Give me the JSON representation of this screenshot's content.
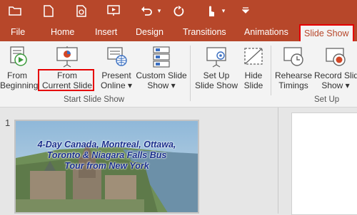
{
  "quick_access": {
    "icons": [
      "open-folder-icon",
      "new-file-icon",
      "print-preview-icon",
      "play-slideshow-icon",
      "undo-icon",
      "dropdown-arrow-icon",
      "redo-icon",
      "touch-mode-icon",
      "dropdown-arrow-icon",
      "customize-qat-icon"
    ]
  },
  "tabs": [
    "File",
    "Home",
    "Insert",
    "Design",
    "Transitions",
    "Animations",
    "Slide Show"
  ],
  "active_tab": "Slide Show",
  "ribbon": {
    "groups": [
      {
        "label": "Start Slide Show",
        "buttons": [
          {
            "line1": "From",
            "line2": "Beginning",
            "icon": "from-beginning-icon"
          },
          {
            "line1": "From",
            "line2": "Current Slide",
            "icon": "from-current-slide-icon",
            "highlighted": true
          },
          {
            "line1": "Present",
            "line2": "Online ▾",
            "icon": "present-online-icon"
          },
          {
            "line1": "Custom Slide",
            "line2": "Show ▾",
            "icon": "custom-slide-show-icon"
          }
        ]
      },
      {
        "label": "Set Up",
        "buttons": [
          {
            "line1": "Set Up",
            "line2": "Slide Show",
            "icon": "set-up-slide-show-icon"
          },
          {
            "line1": "Hide",
            "line2": "Slide",
            "icon": "hide-slide-icon"
          },
          {
            "line1": "Rehearse",
            "line2": "Timings",
            "icon": "rehearse-timings-icon"
          },
          {
            "line1": "Record Slide",
            "line2": "Show ▾",
            "icon": "record-slide-show-icon"
          }
        ]
      }
    ]
  },
  "thumbnail": {
    "slide_number": "1",
    "title_line1": "4-Day Canada, Montreal, Ottawa,",
    "title_line2": "Toronto & Niagara Falls Bus",
    "title_line3": "Tour from New York"
  },
  "colors": {
    "accent": "#b7472a",
    "highlight": "#e60000",
    "ribbon_bg": "#f3f3f3",
    "workspace_bg": "#e6e6e6"
  }
}
